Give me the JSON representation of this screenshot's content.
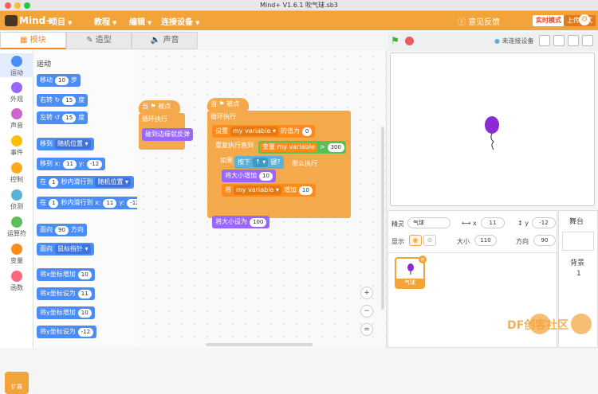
{
  "window": {
    "title": "Mind+ V1.6.1     吹气球.sb3"
  },
  "menubar": {
    "logo": "Mind+",
    "items": [
      {
        "label": "项目"
      },
      {
        "label": "教程"
      },
      {
        "label": "编辑"
      },
      {
        "label": "连接设备"
      }
    ],
    "feedback": "意见反馈",
    "mode_realtime": "实时模式",
    "mode_upload": "上传模式"
  },
  "tabs": {
    "blocks": "模块",
    "costumes": "造型",
    "sounds": "声音"
  },
  "categories": [
    {
      "label": "运动",
      "color": "#4c8cf5"
    },
    {
      "label": "外观",
      "color": "#9966ff"
    },
    {
      "label": "声音",
      "color": "#cf63cf"
    },
    {
      "label": "事件",
      "color": "#ffbf00"
    },
    {
      "label": "控制",
      "color": "#ffab19"
    },
    {
      "label": "侦测",
      "color": "#5cb1d6"
    },
    {
      "label": "运算符",
      "color": "#59c059"
    },
    {
      "label": "变量",
      "color": "#ff8c1a"
    },
    {
      "label": "函数",
      "color": "#ff6680"
    }
  ],
  "extensions": "扩展",
  "palette": {
    "title": "运动",
    "blocks": [
      {
        "parts": [
          {
            "t": "移动"
          },
          {
            "p": "10"
          },
          {
            "t": "步"
          }
        ]
      },
      {
        "parts": [
          {
            "t": "右转 ↻"
          },
          {
            "p": "15"
          },
          {
            "t": "度"
          }
        ]
      },
      {
        "parts": [
          {
            "t": "左转 ↺"
          },
          {
            "p": "15"
          },
          {
            "t": "度"
          }
        ]
      },
      {
        "parts": [
          {
            "t": "移到"
          },
          {
            "d": "随机位置 ▾"
          }
        ]
      },
      {
        "parts": [
          {
            "t": "移到 x:"
          },
          {
            "p": "11"
          },
          {
            "t": "y:"
          },
          {
            "p": "-12"
          }
        ]
      },
      {
        "parts": [
          {
            "t": "在"
          },
          {
            "p": "1"
          },
          {
            "t": "秒内滑行到"
          },
          {
            "d": "随机位置 ▾"
          }
        ]
      },
      {
        "parts": [
          {
            "t": "在"
          },
          {
            "p": "1"
          },
          {
            "t": "秒内滑行到 x:"
          },
          {
            "p": "11"
          },
          {
            "t": "y:"
          },
          {
            "p": "-12"
          }
        ]
      },
      {
        "parts": [
          {
            "t": "面向"
          },
          {
            "p": "90"
          },
          {
            "t": "方向"
          }
        ]
      },
      {
        "parts": [
          {
            "t": "面向"
          },
          {
            "d": "鼠标指针 ▾"
          }
        ]
      },
      {
        "parts": [
          {
            "t": "将x坐标增加"
          },
          {
            "p": "10"
          }
        ]
      },
      {
        "parts": [
          {
            "t": "将x坐标设为"
          },
          {
            "p": "11"
          }
        ]
      },
      {
        "parts": [
          {
            "t": "将y坐标增加"
          },
          {
            "p": "10"
          }
        ]
      },
      {
        "parts": [
          {
            "t": "将y坐标设为"
          },
          {
            "p": "-12"
          }
        ]
      }
    ]
  },
  "script1": {
    "hat": "当 ⚑ 被点击",
    "loop": "循环执行",
    "inner": "碰到边缘就反弹"
  },
  "script2": {
    "hat": "当 ⚑ 被点击",
    "loop": "循环执行",
    "set_label": "设置",
    "set_var": "my variable ▾",
    "set_mid": "的值为",
    "set_val": "0",
    "repeat_label": "重复执行直到",
    "var_name": "变量 my variable",
    "gt": ">",
    "gt_val": "300",
    "if_label": "如果",
    "key_a": "按下",
    "key_b": "↑ ▾",
    "key_c": "键?",
    "if_then": "那么执行",
    "size_change": "将大小增加",
    "size_change_val": "10",
    "change_label": "将",
    "change_var": "my variable ▾",
    "change_mid": "增加",
    "change_val": "10",
    "set_size": "将大小设为",
    "set_size_val": "100"
  },
  "zoom": {
    "in": "+",
    "out": "−",
    "reset": "="
  },
  "stage_bar": {
    "connection": "未连接设备"
  },
  "sprite_info": {
    "sprite_label": "精灵",
    "sprite_name": "气球",
    "x_label": "x",
    "x": "11",
    "y_label": "y",
    "y": "-12",
    "show_label": "显示",
    "size_label": "大小",
    "size": "110",
    "direction_label": "方向",
    "direction": "90",
    "thumb_name": "气球"
  },
  "stage_panel": {
    "title": "舞台",
    "backdrop_label": "背景",
    "backdrop_count": "1"
  },
  "watermark": "DF创客社区",
  "colors": {
    "accent": "#f2a33a",
    "motion": "#4c8cf5",
    "control": "#f4a94b",
    "looks": "#9966ff",
    "operator": "#59c059",
    "variable": "#ff8c1a",
    "sensing": "#5cb1d6"
  }
}
